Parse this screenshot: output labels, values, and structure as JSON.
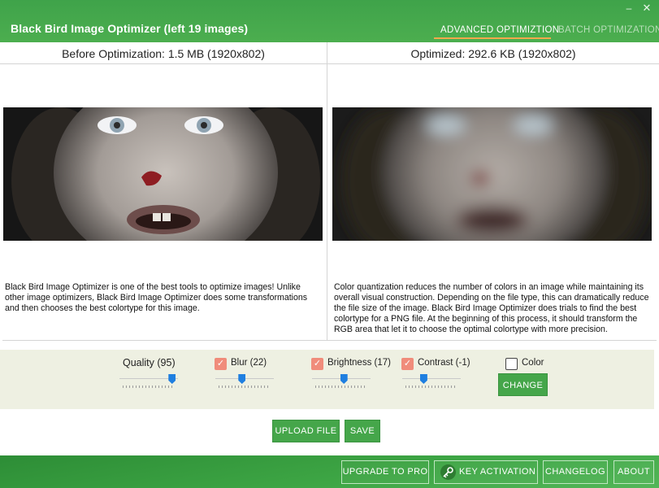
{
  "window": {
    "title": "Black Bird Image Optimizer (left 19 images)",
    "minimize_glyph": "–",
    "close_glyph": "✕"
  },
  "tabs": [
    {
      "label": "ADVANCED OPTIMIZTION",
      "active": true
    },
    {
      "label": "BATCH OPTIMIZATION",
      "active": false
    }
  ],
  "before": {
    "header": "Before Optimization: 1.5 MB (1920x802)",
    "description": "Black Bird Image Optimizer is one of the best tools to optimize images! Unlike other image optimizers, Black Bird Image Optimizer does some transformations and then chooses the best colortype for this image."
  },
  "after": {
    "header": "Optimized: 292.6 KB (1920x802)",
    "description": "Color quantization reduces the number of colors in an image while maintaining its overall visual construction. Depending on the file type, this can dramatically reduce the file size of the image. Black Bird Image Optimizer does trials to find the best colortype for a PNG file. At the beginning of this process, it should transform the RGB area that let it to choose the optimal colortype with more precision."
  },
  "controls": {
    "quality": {
      "label": "Quality (95)",
      "value": 95
    },
    "blur": {
      "label": "Blur (22)",
      "checked": true,
      "level": 0.45
    },
    "brightness": {
      "label": "Brightness (17)",
      "checked": true,
      "level": 0.55
    },
    "contrast": {
      "label": "Contrast (-1)",
      "checked": true,
      "level": 0.35
    },
    "color": {
      "label": "Color",
      "checked": false
    },
    "change_label": "CHANGE",
    "check_glyph": "✓"
  },
  "actions": {
    "upload_label": "UPLOAD FILE",
    "save_label": "SAVE"
  },
  "footer": {
    "upgrade_label": "UPGRADE TO PRO",
    "key_label": "KEY ACTIVATION",
    "changelog_label": "CHANGELOG",
    "about_label": "ABOUT"
  },
  "colors": {
    "brand_green": "#45a64a",
    "checkbox_accent": "#f08c7b",
    "slider_thumb": "#1f7fe0",
    "active_tab_underline": "#f2a84d"
  },
  "icons": {
    "key_activation": "key-icon"
  }
}
